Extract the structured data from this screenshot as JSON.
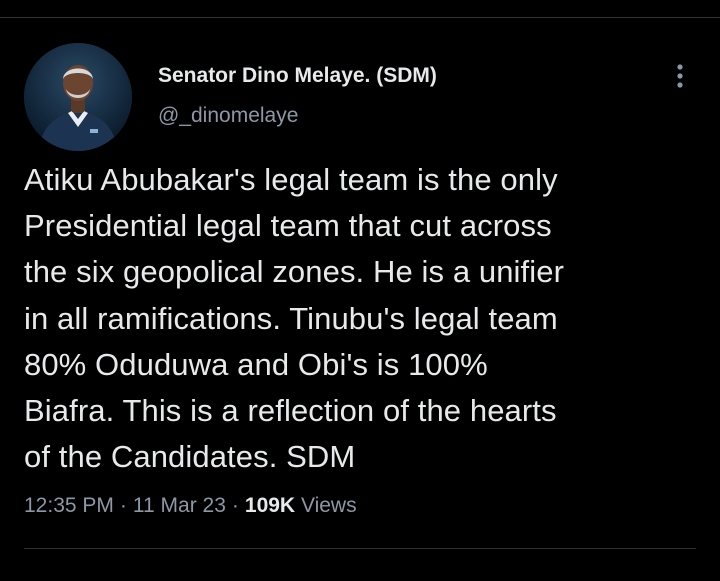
{
  "author": {
    "display_name": "Senator Dino Melaye. (SDM)",
    "handle": "@_dinomelaye",
    "avatar_icon": "profile-photo"
  },
  "more_menu": {
    "icon": "more-vertical-icon"
  },
  "tweet": {
    "lines": [
      "Atiku Abubakar's legal team is the only",
      "Presidential legal team that cut across",
      "the six geopolical zones. He is a unifier",
      "in all ramifications. Tinubu's legal team",
      "80% Oduduwa and Obi's is 100%",
      "Biafra. This is a reflection of the hearts",
      "of the Candidates. SDM"
    ]
  },
  "meta": {
    "time": "12:35 PM",
    "separator": "·",
    "date": "11 Mar 23",
    "views_count": "109K",
    "views_label": "Views"
  },
  "colors": {
    "background": "#000000",
    "primary_text": "#e7e9ea",
    "secondary_text": "#8b98a5",
    "divider": "#2f3336"
  }
}
